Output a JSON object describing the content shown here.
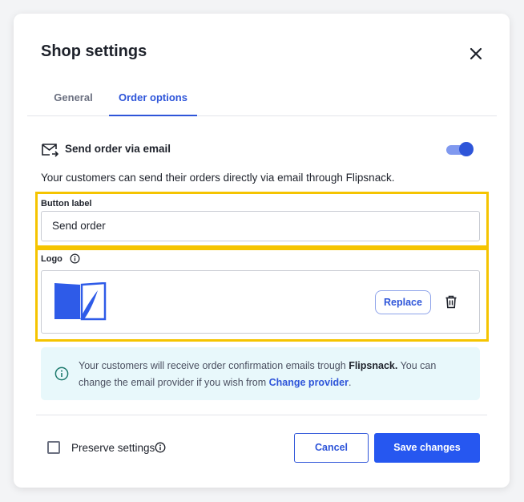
{
  "dialog": {
    "title": "Shop settings"
  },
  "tabs": [
    {
      "label": "General",
      "active": false
    },
    {
      "label": "Order options",
      "active": true
    }
  ],
  "email_section": {
    "title": "Send order via email",
    "toggle_on": true,
    "description": "Your customers can send their orders directly via email through Flipsnack."
  },
  "button_label": {
    "label": "Button label",
    "value": "Send order"
  },
  "logo": {
    "label": "Logo",
    "replace_label": "Replace"
  },
  "info": {
    "text_1": "Your customers will receive order confirmation emails trough ",
    "brand": "Flipsnack.",
    "text_2": " You can change the email provider if you wish from ",
    "link": "Change provider",
    "text_3": "."
  },
  "footer": {
    "preserve_label": "Preserve settings",
    "preserve_checked": false,
    "cancel_label": "Cancel",
    "save_label": "Save changes"
  },
  "icons": {
    "close": "close-icon",
    "email": "email-send-icon",
    "info": "info-icon",
    "trash": "trash-icon",
    "logo": "flipsnack-logo"
  },
  "colors": {
    "accent": "#2e55d9",
    "save_button": "#2657f0",
    "highlight": "#f5c400",
    "info_bg": "#e8f8fb"
  }
}
